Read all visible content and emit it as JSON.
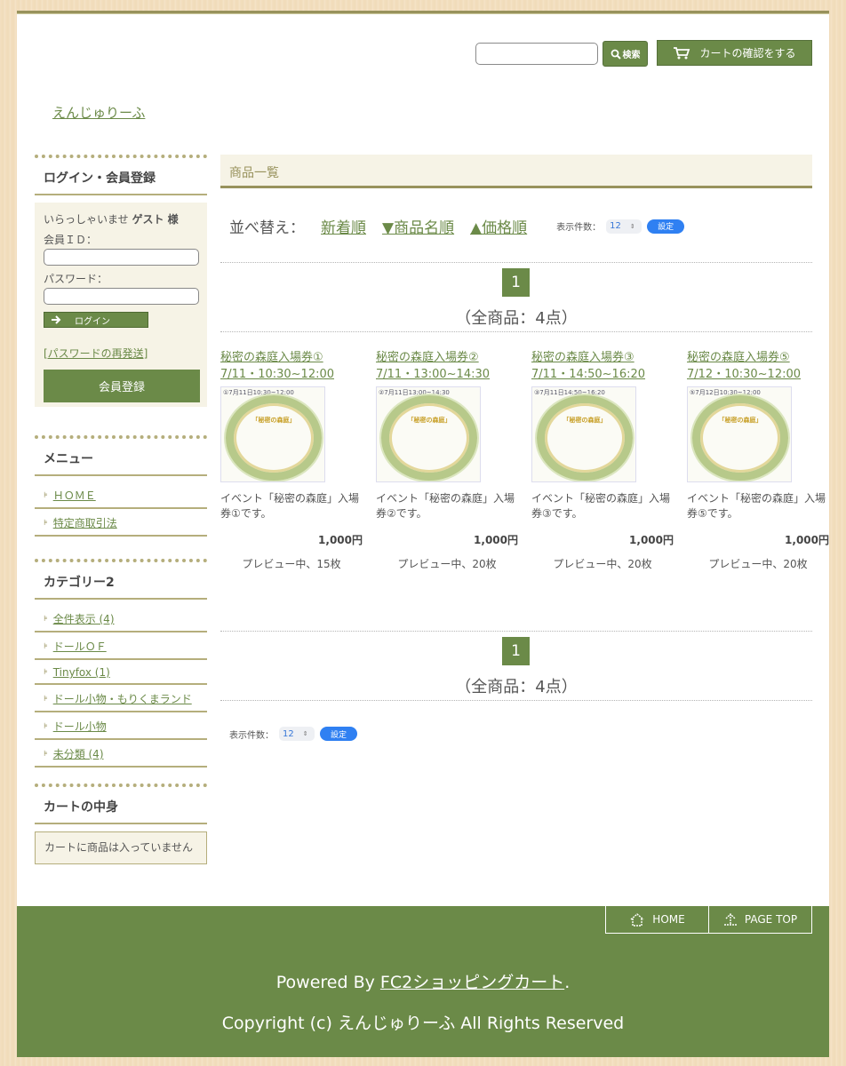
{
  "header": {
    "search_button": "検索",
    "cart_button": "カートの確認をする",
    "site_title": "えんじゅりーふ"
  },
  "sidebar": {
    "login": {
      "heading": "ログイン・会員登録",
      "welcome_prefix": "いらっしゃいませ",
      "welcome_user": "ゲスト 様",
      "id_label": "会員ＩＤ：",
      "password_label": "パスワード：",
      "login_button": "ログイン",
      "password_resend": "[パスワードの再発送]",
      "register_button": "会員登録"
    },
    "menu": {
      "heading": "メニュー",
      "items": [
        "ＨＯＭＥ",
        "特定商取引法"
      ]
    },
    "category": {
      "heading": "カテゴリー2",
      "items": [
        "全件表示 (4)",
        "ドールＯＦ",
        "Tinyfox (1)",
        "ドール小物・もりくまランド",
        "ドール小物",
        "未分類 (4)"
      ]
    },
    "cart": {
      "heading": "カートの中身",
      "empty_text": "カートに商品は入っていません"
    }
  },
  "main": {
    "heading": "商品一覧",
    "sort_label": "並べ替え：",
    "sort_newest": "新着順",
    "sort_name": "▼商品名順",
    "sort_price": "▲価格順",
    "count_label": "表示件数：",
    "count_value": "12",
    "set_button": "設定",
    "page_number": "1",
    "total_text": "（全商品：4点）",
    "products": [
      {
        "title": "秘密の森庭入場券① 7/11・10:30~12:00",
        "image_caption": "①7月11日10:30~12:00",
        "image_title": "「秘密の森庭」",
        "description": "イベント「秘密の森庭」入場券①です。",
        "price": "1,000円",
        "stock": "プレビュー中、15枚"
      },
      {
        "title": "秘密の森庭入場券② 7/11・13:00~14:30",
        "image_caption": "②7月11日13:00~14:30",
        "image_title": "「秘密の森庭」",
        "description": "イベント「秘密の森庭」入場券②です。",
        "price": "1,000円",
        "stock": "プレビュー中、20枚"
      },
      {
        "title": "秘密の森庭入場券③ 7/11・14:50~16:20",
        "image_caption": "③7月11日14:50~16:20",
        "image_title": "「秘密の森庭」",
        "description": "イベント「秘密の森庭」入場券③です。",
        "price": "1,000円",
        "stock": "プレビュー中、20枚"
      },
      {
        "title": "秘密の森庭入場券⑤ 7/12・10:30~12:00",
        "image_caption": "⑤7月12日10:30~12:00",
        "image_title": "「秘密の森庭」",
        "description": "イベント「秘密の森庭」入場券⑤です。",
        "price": "1,000円",
        "stock": "プレビュー中、20枚"
      }
    ]
  },
  "footer": {
    "home_button": "HOME",
    "pagetop_button": "PAGE TOP",
    "powered_prefix": "Powered By",
    "powered_link": "FC2ショッピングカート",
    "powered_suffix": ".",
    "copyright": "Copyright (c) えんじゅりーふ All Rights Reserved"
  },
  "colors": {
    "accent_green": "#6b8a48",
    "olive_border": "#98925c",
    "panel_beige": "#f6f3e6",
    "set_button_blue": "#2f80f2"
  }
}
